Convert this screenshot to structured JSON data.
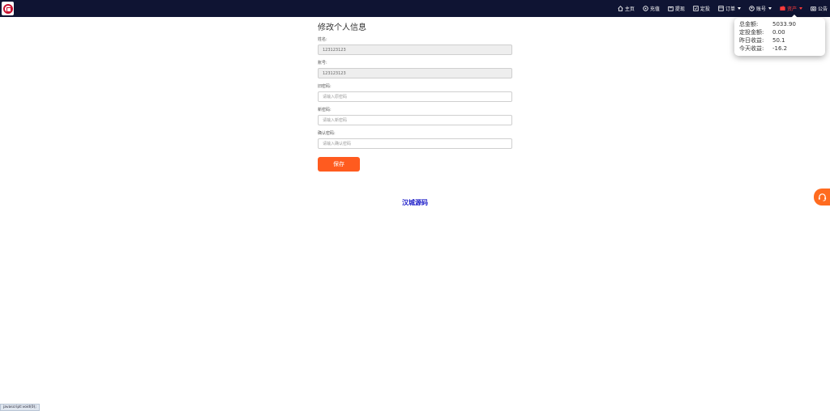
{
  "nav": {
    "items": [
      {
        "label": "主页",
        "icon": "home-icon",
        "has_caret": false,
        "active": false
      },
      {
        "label": "充值",
        "icon": "recharge-icon",
        "has_caret": false,
        "active": false
      },
      {
        "label": "提现",
        "icon": "withdraw-icon",
        "has_caret": false,
        "active": false
      },
      {
        "label": "定投",
        "icon": "invest-icon",
        "has_caret": false,
        "active": false
      },
      {
        "label": "订单",
        "icon": "orders-icon",
        "has_caret": true,
        "active": false
      },
      {
        "label": "账号",
        "icon": "account-icon",
        "has_caret": true,
        "active": false
      },
      {
        "label": "资产",
        "icon": "wallet-icon",
        "has_caret": true,
        "active": true
      },
      {
        "label": "公告",
        "icon": "notice-icon",
        "has_caret": false,
        "active": false
      }
    ]
  },
  "asset_popup": {
    "rows": [
      {
        "label": "总金额:",
        "value": "5033.90"
      },
      {
        "label": "定投金额:",
        "value": "0.00"
      },
      {
        "label": "昨日收益:",
        "value": "50.1"
      },
      {
        "label": "今天收益:",
        "value": "-16.2"
      }
    ]
  },
  "form": {
    "title": "修改个人信息",
    "name_label": "姓名:",
    "name_value": "123123123",
    "account_label": "账号:",
    "account_value": "123123123",
    "old_pwd_label": "旧密码:",
    "old_pwd_placeholder": "请输入原密码",
    "new_pwd_label": "新密码:",
    "new_pwd_placeholder": "请输入新密码",
    "confirm_pwd_label": "确认密码:",
    "confirm_pwd_placeholder": "请输入确认密码",
    "save_label": "保存"
  },
  "brand": {
    "text": "汉城源码"
  },
  "statusbar": {
    "text": "javascript:void(0);"
  },
  "colors": {
    "nav_bg": "#0f1433",
    "accent": "#ff5b1f",
    "active_nav": "#ff3b3b",
    "brand_text": "#1a1ac8"
  }
}
